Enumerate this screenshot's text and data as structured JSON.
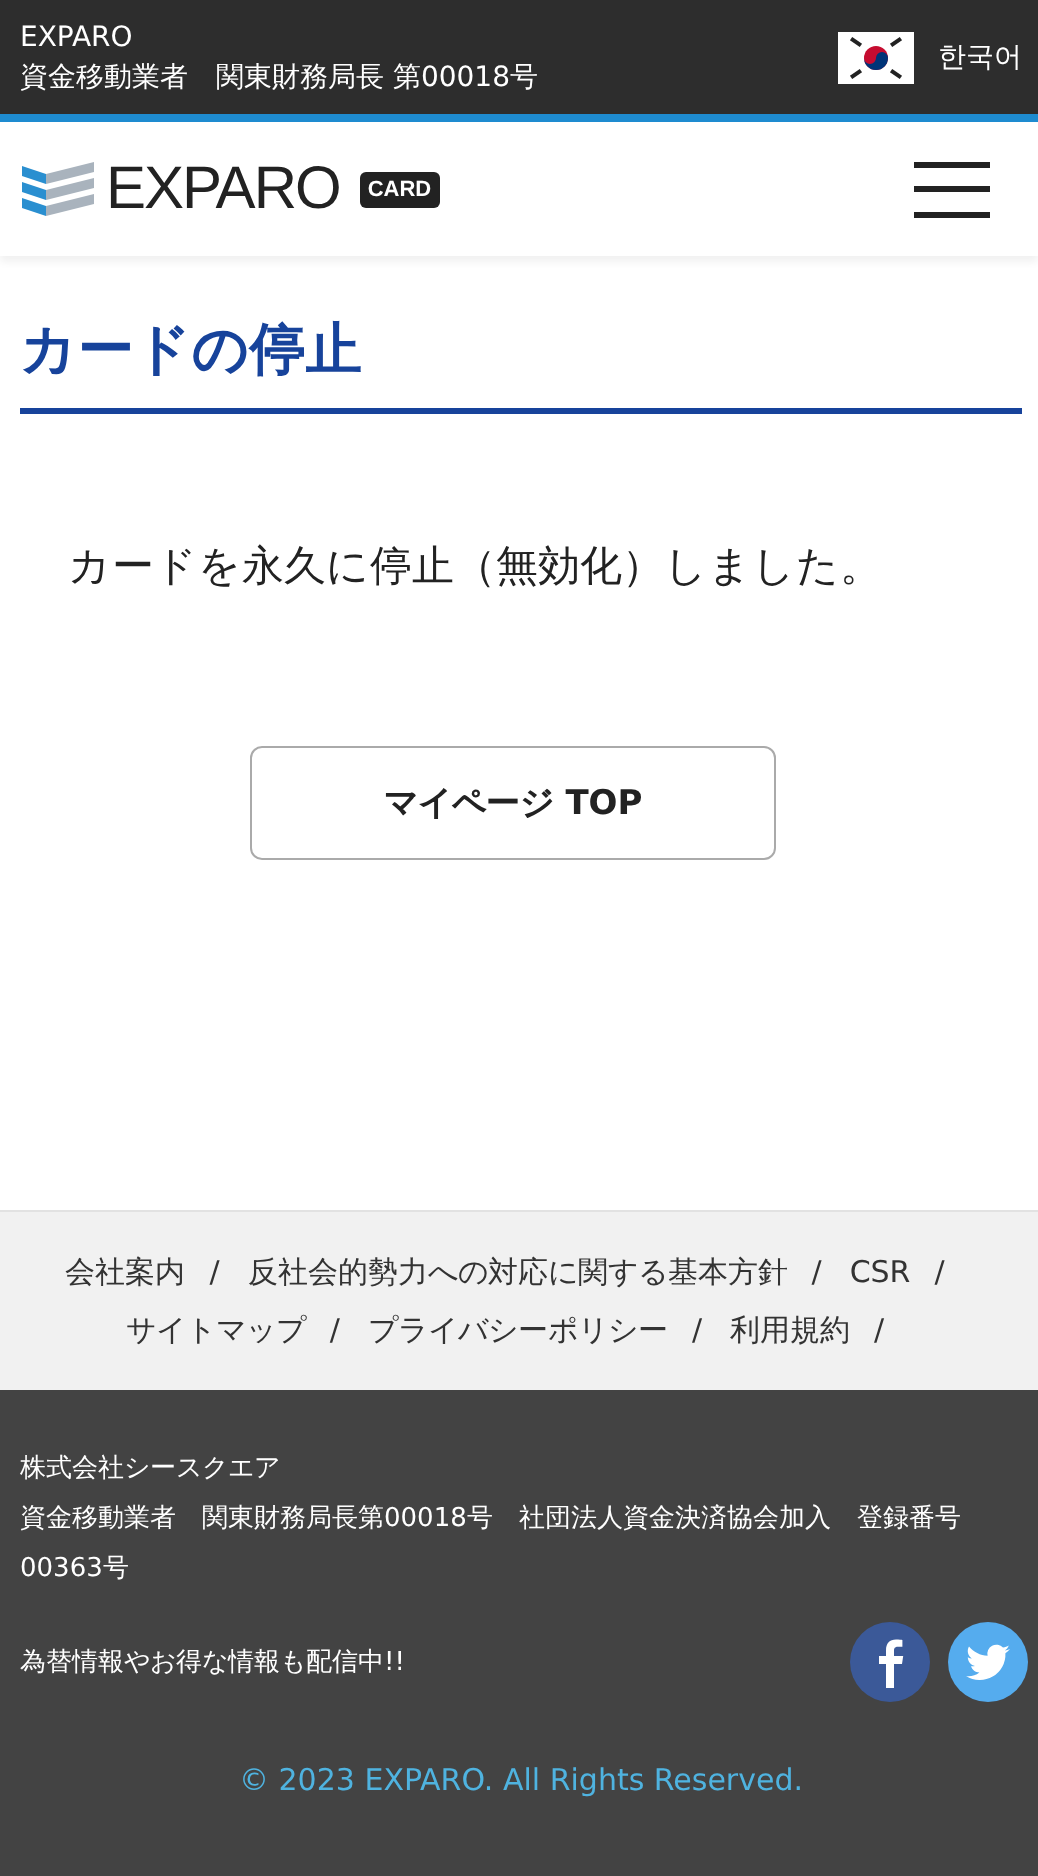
{
  "top_bar": {
    "brand": "EXPARO",
    "license": "資金移動業者　関東財務局長 第00018号",
    "language": "한국어"
  },
  "header": {
    "logo_text": "EXPARO",
    "logo_badge": "CARD"
  },
  "page": {
    "title": "カードの停止",
    "message": "カードを永久に停止（無効化）しました。",
    "button": "マイページ TOP"
  },
  "footer_links": [
    {
      "label": "会社案内",
      "separator": "/"
    },
    {
      "label": "反社会的勢力への対応に関する基本方針",
      "separator": "/"
    },
    {
      "label": "CSR",
      "separator": "/"
    },
    {
      "label": "サイトマップ",
      "separator": "/"
    },
    {
      "label": "プライバシーポリシー",
      "separator": "/"
    },
    {
      "label": "利用規約",
      "separator": "/"
    }
  ],
  "footer": {
    "company": "株式会社シースクエア",
    "registration": "資金移動業者　関東財務局長第00018号　社団法人資金決済協会加入　登録番号00363号",
    "news": "為替情報やお得な情報も配信中!!",
    "copyright": "© 2023 EXPARO. All Rights Reserved."
  }
}
